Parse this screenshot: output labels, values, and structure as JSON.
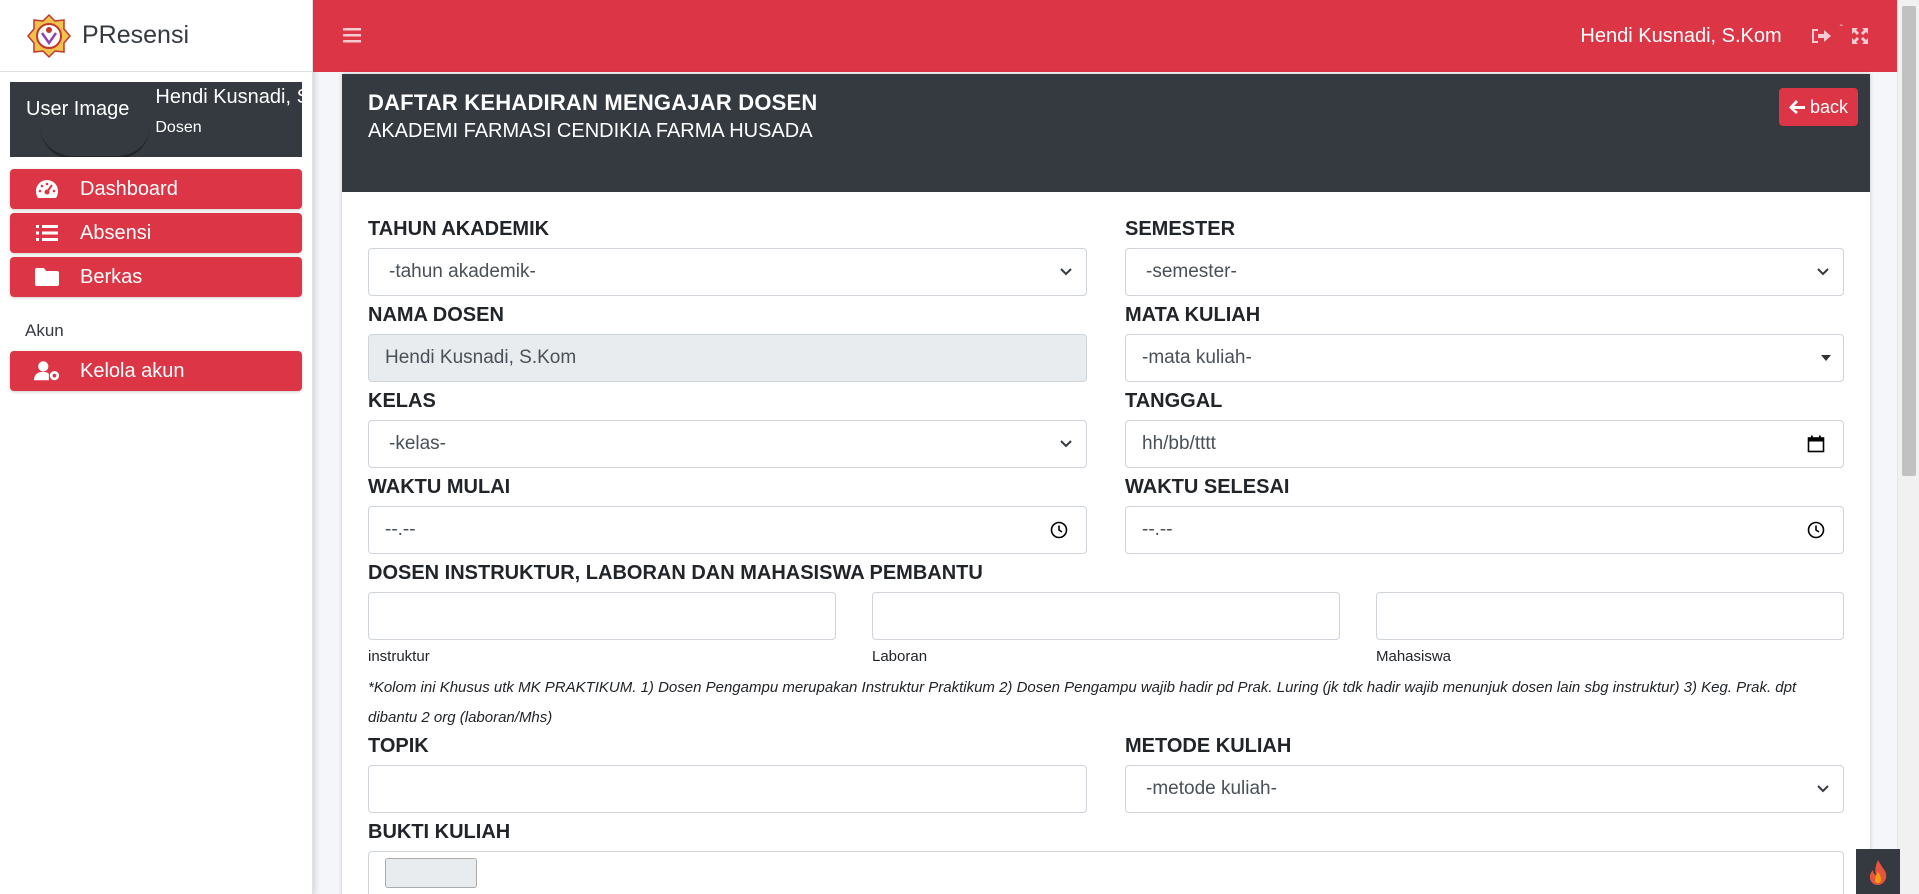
{
  "brand": {
    "name": "PResensi"
  },
  "user_panel": {
    "image_alt": "User Image",
    "name": "Hendi Kusnadi, S.Kom",
    "role": "Dosen"
  },
  "sidebar": {
    "items": [
      {
        "label": "Dashboard",
        "icon": "tachometer-icon"
      },
      {
        "label": "Absensi",
        "icon": "list-icon"
      },
      {
        "label": "Berkas",
        "icon": "folder-icon"
      }
    ],
    "section_header": "Akun",
    "account_items": [
      {
        "label": "Kelola akun",
        "icon": "user-cog-icon"
      }
    ]
  },
  "topbar": {
    "user_name": "Hendi Kusnadi, S.Kom"
  },
  "card": {
    "title": "DAFTAR KEHADIRAN MENGAJAR DOSEN",
    "subtitle": "AKADEMI FARMASI CENDIKIA FARMA HUSADA",
    "back_label": "back"
  },
  "form": {
    "tahun_akademik": {
      "label": "TAHUN AKADEMIK",
      "value": "-tahun akademik-"
    },
    "semester": {
      "label": "SEMESTER",
      "value": "-semester-"
    },
    "nama_dosen": {
      "label": "NAMA DOSEN",
      "value": "Hendi Kusnadi, S.Kom"
    },
    "mata_kuliah": {
      "label": "MATA KULIAH",
      "value": "-mata kuliah-"
    },
    "kelas": {
      "label": "KELAS",
      "value": "-kelas-"
    },
    "tanggal": {
      "label": "TANGGAL",
      "value": "hh/bb/tttt"
    },
    "waktu_mulai": {
      "label": "WAKTU MULAI",
      "value": "--.--"
    },
    "waktu_selesai": {
      "label": "WAKTU SELESAI",
      "value": "--.--"
    },
    "pembantu": {
      "label": "DOSEN INSTRUKTUR, LABORAN DAN MAHASISWA PEMBANTU",
      "instruktur_label": "instruktur",
      "laboran_label": "Laboran",
      "mahasiswa_label": "Mahasiswa",
      "note": "*Kolom ini Khusus utk MK PRAKTIKUM. 1) Dosen Pengampu merupakan Instruktur Praktikum 2) Dosen Pengampu wajib hadir pd Prak. Luring (jk tdk hadir wajib menunjuk dosen lain sbg instruktur) 3) Keg. Prak. dpt dibantu 2 org (laboran/Mhs)"
    },
    "topik": {
      "label": "TOPIK",
      "value": ""
    },
    "metode_kuliah": {
      "label": "METODE KULIAH",
      "value": "-metode kuliah-"
    },
    "bukti_kuliah": {
      "label": "BUKTI KULIAH"
    }
  },
  "colors": {
    "accent": "#dc3545",
    "header_dark": "#343a40"
  }
}
